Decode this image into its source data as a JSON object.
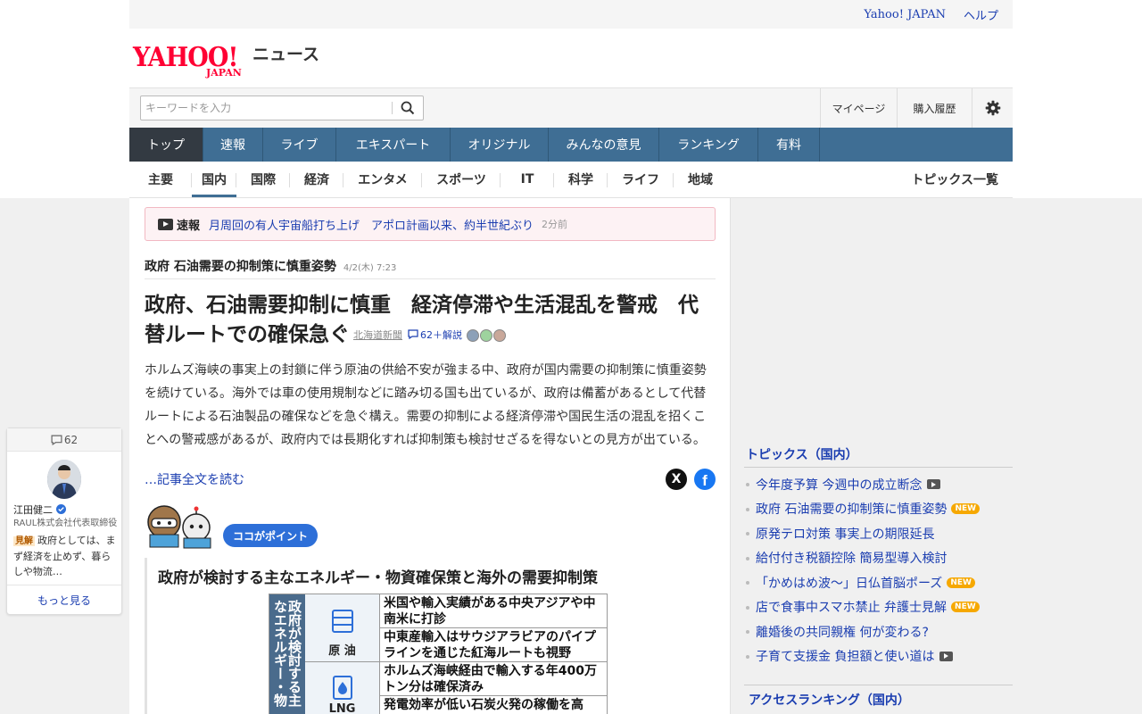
{
  "util": {
    "yahoo_japan": "Yahoo! JAPAN",
    "help": "ヘルプ"
  },
  "logo": {
    "yahoo": "YAHOO!",
    "japan": "JAPAN",
    "news": "ニュース"
  },
  "search": {
    "placeholder": "キーワードを入力"
  },
  "account": {
    "mypage": "マイページ",
    "history": "購入履歴"
  },
  "main_nav": [
    "トップ",
    "速報",
    "ライブ",
    "エキスパート",
    "オリジナル",
    "みんなの意見",
    "ランキング",
    "有料"
  ],
  "sub_nav": [
    "主要",
    "国内",
    "国際",
    "経済",
    "エンタメ",
    "スポーツ",
    "IT",
    "科学",
    "ライフ",
    "地域"
  ],
  "topics_all": "トピックス一覧",
  "breaking": {
    "label": "速報",
    "text": "月周回の有人宇宙船打ち上げ　アポロ計画以来、約半世紀ぶり",
    "time": "2分前"
  },
  "article": {
    "topic_title": "政府 石油需要の抑制策に慎重姿勢",
    "topic_date": "4/2(木) 7:23",
    "title": "政府、石油需要抑制に慎重　経済停滞や生活混乱を警戒　代替ルートでの確保急ぐ",
    "source": "北海道新聞",
    "comments": "62＋解説",
    "body": "ホルムズ海峡の事実上の封鎖に伴う原油の供給不安が強まる中、政府が国内需要の抑制策に慎重姿勢を続けている。海外では車の使用規制などに踏み切る国も出ているが、政府は備蓄があるとして代替ルートによる石油製品の確保などを急ぐ構え。需要の抑制による経済停滞や国民生活の混乱を招くことへの警戒感があるが、政府内では長期化すれば抑制策も検討せざるを得ないとの見方が出ている。",
    "read_more": "…記事全文を読む",
    "x_label": "X",
    "fb_label": "f",
    "point_label": "ココがポイント",
    "point_heading": "政府が検討する主なエネルギー・物資確保策と海外の需要抑制策",
    "figure": {
      "vertical": "政府が検討する主なエネルギー・物",
      "cat1": "原 油",
      "cat2": "LNG",
      "rows": [
        "米国や輸入実績がある中央アジアや中南米に打診",
        "中東産輸入はサウジアラビアのパイプラインを通じた紅海ルートも視野",
        "ホルムズ海峡経由で輸入する年400万トン分は確保済み",
        "発電効率が低い石炭火発の稼働を高"
      ]
    }
  },
  "comment_card": {
    "count": "62",
    "name": "江田健二",
    "company": "RAUL株式会社代表取締役",
    "badge": "見解",
    "text": "政府としては、まず経済を止めず、暮らしや物流…",
    "more": "もっと見る"
  },
  "topics": {
    "heading": "トピックス（国内）",
    "items": [
      {
        "text": "今年度予算 今週中の成立断念",
        "tag": "video"
      },
      {
        "text": "政府 石油需要の抑制策に慎重姿勢",
        "tag": "NEW"
      },
      {
        "text": "原発テロ対策 事実上の期限延長",
        "tag": ""
      },
      {
        "text": "給付付き税額控除 簡易型導入検討",
        "tag": ""
      },
      {
        "text": "「かめはめ波～」日仏首脳ポーズ",
        "tag": "NEW"
      },
      {
        "text": "店で食事中スマホ禁止 弁護士見解",
        "tag": "NEW"
      },
      {
        "text": "離婚後の共同親権 何が変わる?",
        "tag": ""
      },
      {
        "text": "子育て支援金 負担額と使い道は",
        "tag": "video"
      }
    ]
  },
  "access_ranking": {
    "heading": "アクセスランキング（国内）"
  }
}
